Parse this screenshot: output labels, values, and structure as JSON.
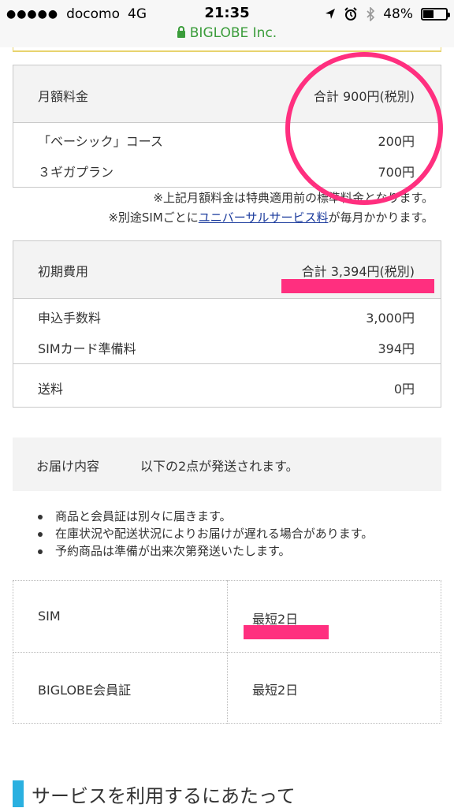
{
  "status_bar": {
    "carrier": "docomo",
    "network": "4G",
    "time": "21:35",
    "battery": "48%",
    "battery_level": 0.48,
    "url": "BIGLOBE Inc."
  },
  "monthly": {
    "header_label": "月額料金",
    "header_total": "合計 900円(税別)",
    "rows": [
      {
        "label": "「ベーシック」コース",
        "value": "200円"
      },
      {
        "label": "３ギガプラン",
        "value": "700円"
      }
    ],
    "note1": "※上記月額料金は特典適用前の標準料金となります。",
    "note2_prefix": "※別途SIMごとに",
    "note2_link": "ユニバーサルサービス料",
    "note2_suffix": "が毎月かかります。"
  },
  "initial": {
    "header_label": "初期費用",
    "header_total": "合計 3,394円(税別)",
    "rows": [
      {
        "label": "申込手数料",
        "value": "3,000円"
      },
      {
        "label": "SIMカード準備料",
        "value": "394円"
      },
      {
        "label": "送料",
        "value": "0円"
      }
    ]
  },
  "delivery": {
    "label": "お届け内容",
    "desc": "以下の2点が発送されます。",
    "bullets": [
      "商品と会員証は別々に届きます。",
      "在庫状況や配送状況によりお届けが遅れる場合があります。",
      "予約商品は準備が出来次第発送いたします。"
    ],
    "items": [
      {
        "name": "SIM",
        "time": "最短2日"
      },
      {
        "name": "BIGLOBE会員証",
        "time": "最短2日"
      }
    ]
  },
  "section": {
    "title": "サービスを利用するにあたって"
  },
  "colors": {
    "annotation": "#ff2f7f",
    "accent": "#2ab0e0",
    "link": "#1a3a9c",
    "secure": "#3a9c3a"
  }
}
